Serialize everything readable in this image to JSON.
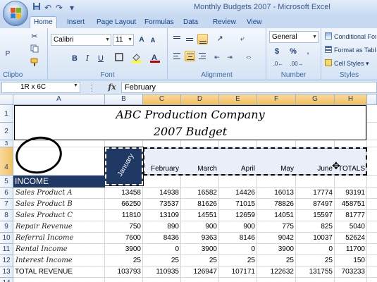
{
  "window": {
    "title": "Monthly Budgets 2007 - Microsoft Excel",
    "qat": [
      "save-icon",
      "undo-icon",
      "redo-icon",
      "customize-icon"
    ]
  },
  "tabs": [
    "Home",
    "Insert",
    "Page Layout",
    "Formulas",
    "Data",
    "Review",
    "View"
  ],
  "ribbon": {
    "clipboard": {
      "label": "Clipbo",
      "paste": "P"
    },
    "font": {
      "label": "Font",
      "name": "Calibri",
      "size": "11",
      "bold": "B",
      "italic": "I",
      "underline": "U"
    },
    "alignment": {
      "label": "Alignment"
    },
    "number": {
      "label": "Number",
      "format": "General",
      "currency": "$",
      "percent": "%"
    },
    "styles": {
      "label": "Styles",
      "conditional": "Conditional For",
      "format_table": "Format as Table",
      "cell_styles": "Cell Styles"
    }
  },
  "formula_bar": {
    "name_box": "1R x 6C",
    "fx": "fx",
    "content": "February"
  },
  "columns": [
    "A",
    "B",
    "C",
    "D",
    "E",
    "F",
    "G",
    "H"
  ],
  "rows": [
    "1",
    "2",
    "3",
    "4",
    "5",
    "6",
    "7",
    "8",
    "9",
    "10",
    "11",
    "12",
    "13",
    "14"
  ],
  "sheet": {
    "title_line1": "ABC Production Company",
    "title_line2": "2007 Budget",
    "months": [
      "January",
      "February",
      "March",
      "April",
      "May",
      "June",
      "TOTALS"
    ],
    "income_label": "INCOME",
    "data_rows": [
      {
        "label": "Sales Product A",
        "values": [
          "13458",
          "14938",
          "16582",
          "14426",
          "16013",
          "17774",
          "93191"
        ]
      },
      {
        "label": "Sales Product B",
        "values": [
          "66250",
          "73537",
          "81626",
          "71015",
          "78826",
          "87497",
          "458751"
        ]
      },
      {
        "label": "Sales Product C",
        "values": [
          "11810",
          "13109",
          "14551",
          "12659",
          "14051",
          "15597",
          "81777"
        ]
      },
      {
        "label": "Repair Revenue",
        "values": [
          "750",
          "890",
          "900",
          "900",
          "775",
          "825",
          "5040"
        ]
      },
      {
        "label": "Referral Income",
        "values": [
          "7600",
          "8436",
          "9363",
          "8146",
          "9042",
          "10037",
          "52624"
        ]
      },
      {
        "label": "Rental Income",
        "values": [
          "3900",
          "0",
          "3900",
          "0",
          "3900",
          "0",
          "11700"
        ]
      },
      {
        "label": "Interest Income",
        "values": [
          "25",
          "25",
          "25",
          "25",
          "25",
          "25",
          "150"
        ]
      }
    ],
    "total_row": {
      "label": "TOTAL REVENUE",
      "values": [
        "103793",
        "110935",
        "126947",
        "107171",
        "122632",
        "131755",
        "703233"
      ]
    }
  }
}
